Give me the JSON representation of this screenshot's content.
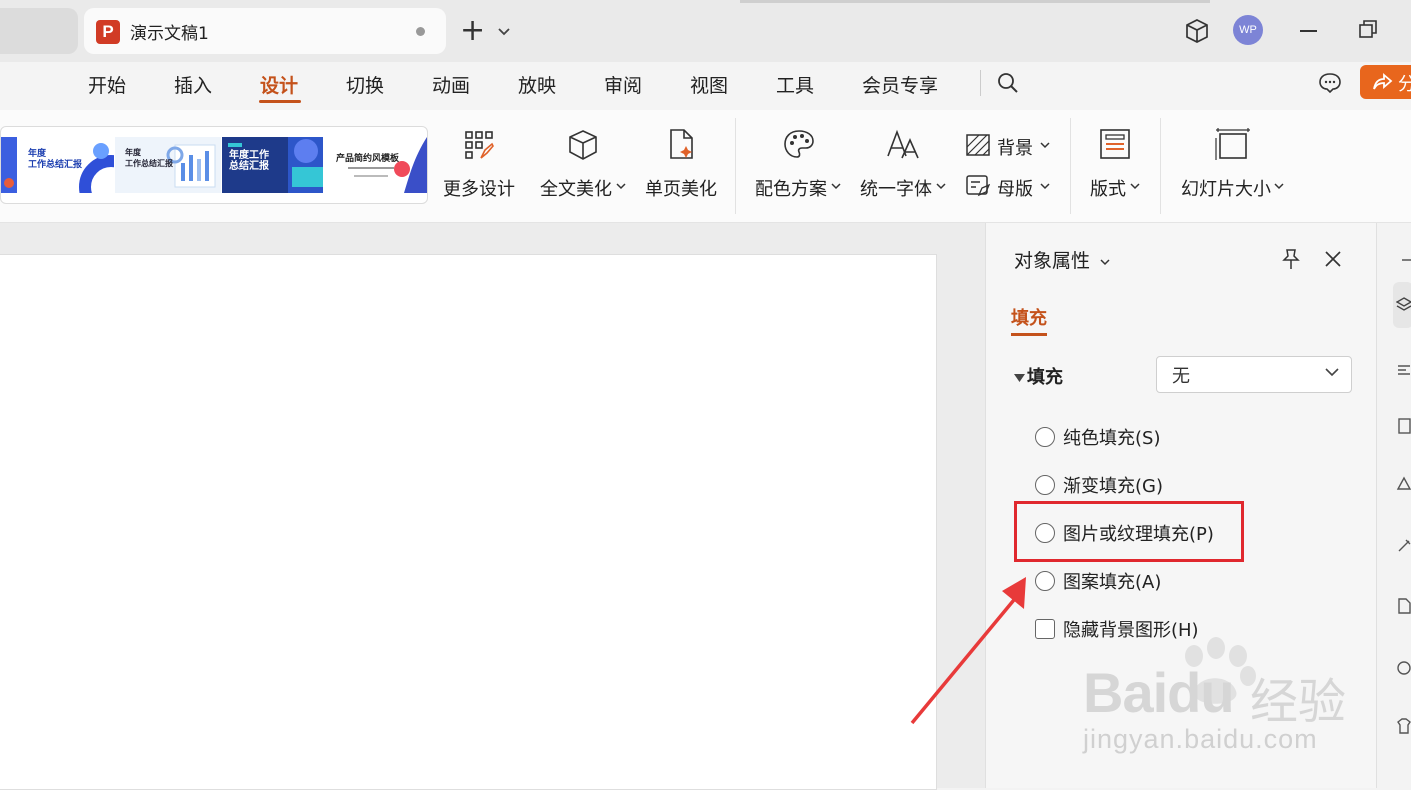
{
  "window": {
    "tab_title": "演示文稿1",
    "app_icon_letter": "P",
    "avatar_text": "WP"
  },
  "menu": {
    "items": [
      "开始",
      "插入",
      "设计",
      "切换",
      "动画",
      "放映",
      "审阅",
      "视图",
      "工具",
      "会员专享"
    ],
    "active": "设计",
    "share_label": "分"
  },
  "ribbon": {
    "templates": [
      {
        "line1": "年度",
        "line2": "工作总结汇报"
      },
      {
        "line1": "年度",
        "line2": "工作总结汇报"
      },
      {
        "line1": "年度工作",
        "line2": "总结汇报"
      },
      {
        "line1": "产品简约风模板",
        "line2": ""
      }
    ],
    "more_design": "更多设计",
    "full_beautify": "全文美化",
    "single_beautify": "单页美化",
    "color_scheme": "配色方案",
    "unify_font": "统一字体",
    "background": "背景",
    "master": "母版",
    "layout": "版式",
    "slide_size": "幻灯片大小"
  },
  "panel": {
    "title": "对象属性",
    "tab_fill": "填充",
    "section_fill": "填充",
    "fill_select_value": "无",
    "options": [
      {
        "label": "纯色填充(S)",
        "type": "radio",
        "checked": false
      },
      {
        "label": "渐变填充(G)",
        "type": "radio",
        "checked": false
      },
      {
        "label": "图片或纹理填充(P)",
        "type": "radio",
        "checked": false,
        "highlighted": true
      },
      {
        "label": "图案填充(A)",
        "type": "radio",
        "checked": false
      },
      {
        "label": "隐藏背景图形(H)",
        "type": "checkbox",
        "checked": false
      }
    ]
  },
  "watermark": {
    "brand": "Bai",
    "brand2": "du",
    "cn": "经验",
    "url": "jingyan.baidu.com"
  },
  "colors": {
    "accent": "#c4521b",
    "highlight": "#e0282e",
    "share": "#e8661d"
  }
}
